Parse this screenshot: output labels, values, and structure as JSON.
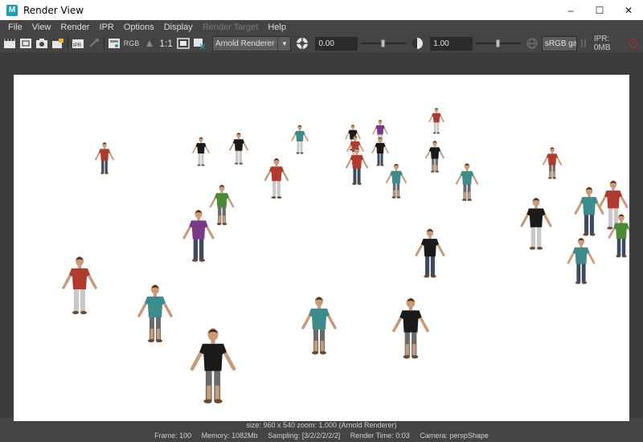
{
  "window": {
    "title": "Render View",
    "minimize": "–",
    "maximize": "☐",
    "close": "✕"
  },
  "menu": {
    "items": [
      {
        "label": "File",
        "enabled": true
      },
      {
        "label": "View",
        "enabled": true
      },
      {
        "label": "Render",
        "enabled": true
      },
      {
        "label": "IPR",
        "enabled": true
      },
      {
        "label": "Options",
        "enabled": true
      },
      {
        "label": "Display",
        "enabled": true
      },
      {
        "label": "Render Target",
        "enabled": false
      },
      {
        "label": "Help",
        "enabled": true
      }
    ]
  },
  "toolbar": {
    "rgb_label": "RGB",
    "one_to_one": "1:1",
    "renderer": "Arnold Renderer",
    "exposure": "0.00",
    "exposure_slider": 0.5,
    "gamma": "1.00",
    "gamma_slider": 0.5,
    "color_space": "sRGB gamma",
    "ipr_memory": "IPR: 0MB"
  },
  "status": {
    "line1": "size: 960 x 540  zoom: 1.000      (Arnold Renderer)",
    "frame": "Frame: 100",
    "memory": "Memory: 1082Mb",
    "sampling": "Sampling: [3/2/2/2/2/2]",
    "render_time": "Render Time: 0:03",
    "camera": "Camera: perspShape"
  },
  "colors": {
    "shirt_red": "#b03a2e",
    "shirt_black": "#1a1a1a",
    "shirt_teal": "#3e8b8b",
    "shirt_green": "#4c8a3a",
    "shirt_purple": "#7a3a8a",
    "pants_jeans": "#3e4a5e",
    "pants_light": "#c8c8c8",
    "shorts_grey": "#6a6a6a",
    "skin": "#c89a78",
    "hair": "#3a2a1e"
  }
}
